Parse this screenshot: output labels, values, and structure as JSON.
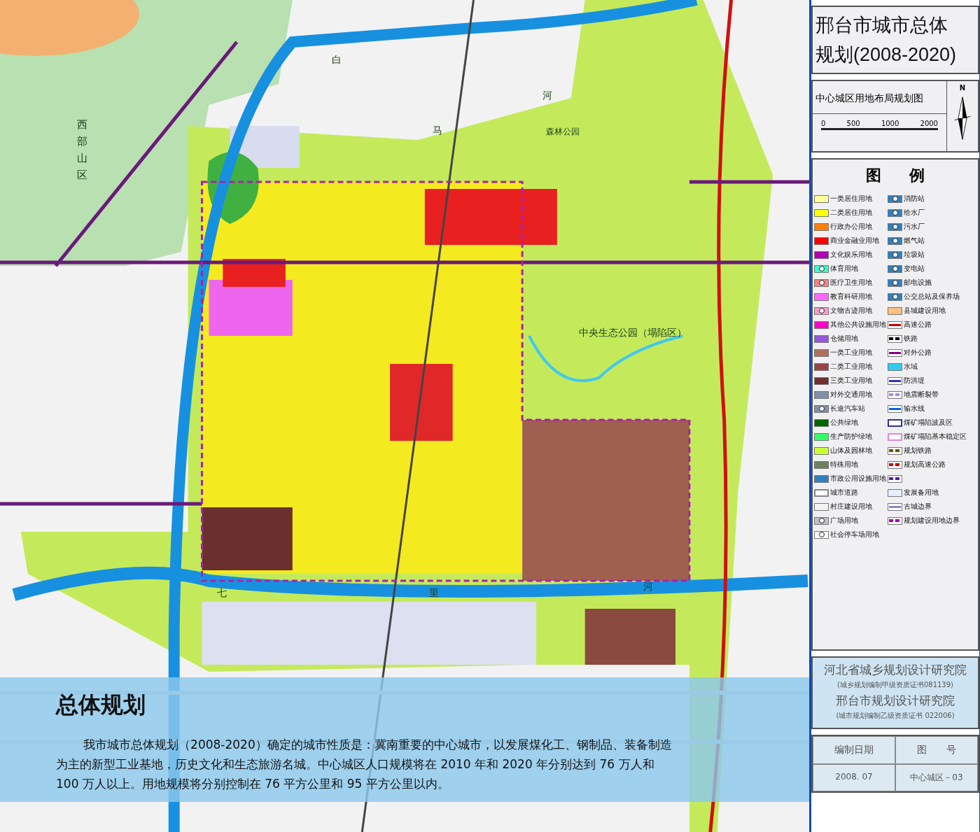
{
  "map": {
    "labels": [
      {
        "text": "西部山区",
        "kind": "vertical"
      },
      {
        "text": "白",
        "kind": "plain"
      },
      {
        "text": "马",
        "kind": "plain"
      },
      {
        "text": "河",
        "kind": "plain"
      },
      {
        "text": "森林公园",
        "kind": "small"
      },
      {
        "text": "中央生态公园（塌陷区）",
        "kind": "plain"
      },
      {
        "text": "七",
        "kind": "plain"
      },
      {
        "text": "里",
        "kind": "plain"
      },
      {
        "text": "河",
        "kind": "plain"
      }
    ]
  },
  "caption": {
    "title": "总体规划",
    "text": "我市城市总体规划（2008-2020）确定的城市性质是：冀南重要的中心城市，以发展煤化工、钢制品、装备制造为主的新型工业基地，历史文化和生态旅游名城。中心城区人口规模将在 2010 年和 2020 年分别达到 76 万人和 100 万人以上。用地规模将分别控制在 76 平方公里和 95 平方公里以内。"
  },
  "panel": {
    "title_lines": [
      "邢台市城市总体",
      "规划(2008-2020)"
    ],
    "subtitle": "中心城区用地布局规划图",
    "scale_labels": [
      "0",
      "500",
      "1000",
      "2000"
    ],
    "north_label": "N",
    "legend": {
      "heading": [
        "图",
        "例"
      ],
      "columns": [
        [
          {
            "label": "一类居住用地",
            "kind": "fill",
            "color": "#ffff99"
          },
          {
            "label": "二类居住用地",
            "kind": "fill",
            "color": "#ffff00"
          },
          {
            "label": "行政办公用地",
            "kind": "fill",
            "color": "#ff8000"
          },
          {
            "label": "商业金融业用地",
            "kind": "fill",
            "color": "#ff0000"
          },
          {
            "label": "文化娱乐用地",
            "kind": "fill",
            "color": "#b000b0"
          },
          {
            "label": "体育用地",
            "kind": "symbol",
            "color": "#33ffcc"
          },
          {
            "label": "医疗卫生用地",
            "kind": "symbol",
            "color": "#ff7f7f"
          },
          {
            "label": "教育科研用地",
            "kind": "fill",
            "color": "#ff66ff"
          },
          {
            "label": "文物古迹用地",
            "kind": "symbol",
            "color": "#ff99cc"
          },
          {
            "label": "其他公共设施用地",
            "kind": "fill",
            "color": "#ff00cc"
          },
          {
            "label": "仓储用地",
            "kind": "fill",
            "color": "#9955dd"
          },
          {
            "label": "一类工业用地",
            "kind": "fill",
            "color": "#b07060"
          },
          {
            "label": "二类工业用地",
            "kind": "fill",
            "color": "#994444"
          },
          {
            "label": "三类工业用地",
            "kind": "fill",
            "color": "#703030"
          },
          {
            "label": "对外交通用地",
            "kind": "fill",
            "color": "#8090a8"
          },
          {
            "label": "长途汽车站",
            "kind": "symbol",
            "color": "#8090a8"
          },
          {
            "label": "公共绿地",
            "kind": "fill",
            "color": "#006600"
          },
          {
            "label": "生产防护绿地",
            "kind": "fill",
            "color": "#33ff66"
          },
          {
            "label": "山体及园林地",
            "kind": "fill",
            "color": "#ccff33"
          },
          {
            "label": "特殊用地",
            "kind": "fill",
            "color": "#708060"
          },
          {
            "label": "市政公用设施用地",
            "kind": "fill",
            "color": "#3080c0"
          },
          {
            "label": "城市道路",
            "kind": "outline",
            "color": "#888888"
          },
          {
            "label": "村庄建设用地",
            "kind": "fill",
            "color": "#f4f4f4"
          },
          {
            "label": "广场用地",
            "kind": "symbol",
            "color": "#c0c0c0"
          },
          {
            "label": "社会停车场用地",
            "kind": "symbol",
            "color": "#ffffff"
          }
        ],
        [
          {
            "label": "消防站",
            "kind": "symbol",
            "color": "#3080c0"
          },
          {
            "label": "给水厂",
            "kind": "symbol",
            "color": "#3080c0"
          },
          {
            "label": "污水厂",
            "kind": "symbol",
            "color": "#3080c0"
          },
          {
            "label": "燃气站",
            "kind": "symbol",
            "color": "#3080c0"
          },
          {
            "label": "垃圾站",
            "kind": "symbol",
            "color": "#3080c0"
          },
          {
            "label": "变电站",
            "kind": "symbol",
            "color": "#3080c0"
          },
          {
            "label": "邮电设施",
            "kind": "symbol",
            "color": "#3080c0"
          },
          {
            "label": "公交总站及保养场",
            "kind": "symbol",
            "color": "#3080c0"
          },
          {
            "label": "县城建设用地",
            "kind": "fill",
            "color": "#ffc080"
          },
          {
            "label": "高速公路",
            "kind": "line",
            "color": "#cc0000"
          },
          {
            "label": "铁路",
            "kind": "dash",
            "color": "#000000"
          },
          {
            "label": "对外公路",
            "kind": "line",
            "color": "#800080"
          },
          {
            "label": "水域",
            "kind": "fill",
            "color": "#33ccee"
          },
          {
            "label": "防洪堤",
            "kind": "line",
            "color": "#3333aa"
          },
          {
            "label": "地震断裂带",
            "kind": "dash",
            "color": "#aa88dd"
          },
          {
            "label": "输水线",
            "kind": "line",
            "color": "#0066dd"
          },
          {
            "label": "煤矿塌陷波及区",
            "kind": "outline",
            "color": "#333399"
          },
          {
            "label": "煤矿塌陷基本稳定区",
            "kind": "outline",
            "color": "#dd88dd"
          },
          {
            "label": "规划铁路",
            "kind": "dash",
            "color": "#665500"
          },
          {
            "label": "规划高速公路",
            "kind": "dash",
            "color": "#cc0000"
          },
          {
            "kind": "dash",
            "color": "#5522aa"
          },
          {
            "label": "发展备用地",
            "kind": "fill",
            "color": "#e8eeff"
          },
          {
            "label": "古城边界",
            "kind": "line",
            "color": "#8888bb"
          },
          {
            "label": "规划建设用地边界",
            "kind": "dash",
            "color": "#aa00aa"
          }
        ]
      ]
    },
    "institutes": [
      {
        "name": "河北省城乡规划设计研究院",
        "note": "(城乡规划编制甲级资质证书081139)"
      },
      {
        "name": "邢台市规划设计研究院",
        "note": "(城市规划编制乙级资质证书 022006)"
      }
    ],
    "info_table": {
      "headers": [
        "编制日期",
        "图　　号"
      ],
      "values": [
        "2008. 07",
        "中心城区－03"
      ]
    }
  }
}
